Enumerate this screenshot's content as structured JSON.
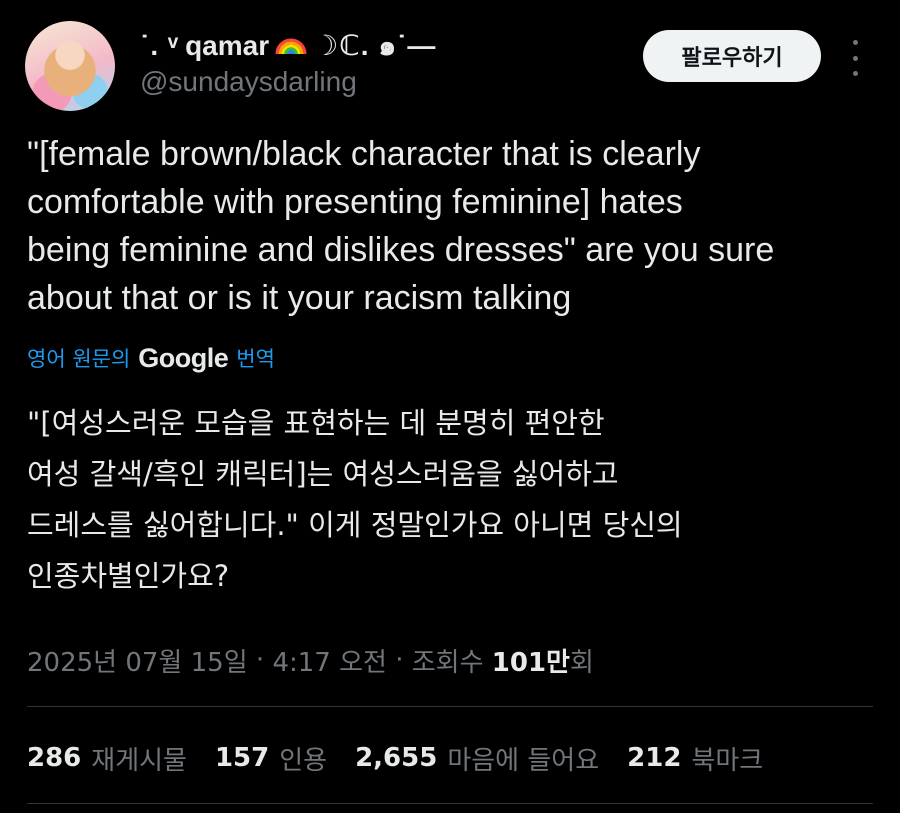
{
  "author": {
    "display_name_prefix": "˙. ᵛ",
    "display_name": "qamar",
    "display_name_suffix": "☽ℂ. ๑˙—",
    "handle": "@sundaysdarling",
    "avatar_icon": "avatar"
  },
  "follow_button": {
    "label": "팔로우하기"
  },
  "more_icon": "more-icon",
  "tweet": {
    "text": "\"[female brown/black character that is clearly\ncomfortable with presenting feminine] hates\nbeing feminine and dislikes dresses\" are you sure\nabout that or is it your racism talking"
  },
  "translation": {
    "prefix": "영어 원문의",
    "provider": "Google",
    "suffix": "번역",
    "text": "\"[여성스러운 모습을 표현하는 데 분명히 편안한\n여성 갈색/흑인 캐릭터]는 여성스러움을 싫어하고\n드레스를 싫어합니다.\" 이게 정말인가요 아니면 당신의\n인종차별인가요?"
  },
  "meta": {
    "date": "2025년 07월 15일",
    "sep1": " · ",
    "time": "4:17 오전",
    "sep2": " · ",
    "views_label": "조회수 ",
    "views_count": "101만",
    "views_suffix": "회"
  },
  "stats": [
    {
      "count": "286",
      "label": "재게시물"
    },
    {
      "count": "157",
      "label": "인용"
    },
    {
      "count": "2,655",
      "label": "마음에 들어요"
    },
    {
      "count": "212",
      "label": "북마크"
    }
  ],
  "colors": {
    "background": "#000000",
    "text": "#e7e9ea",
    "muted": "#71767b",
    "link": "#1d9bf0",
    "follow_button_bg": "#eff3f4"
  }
}
